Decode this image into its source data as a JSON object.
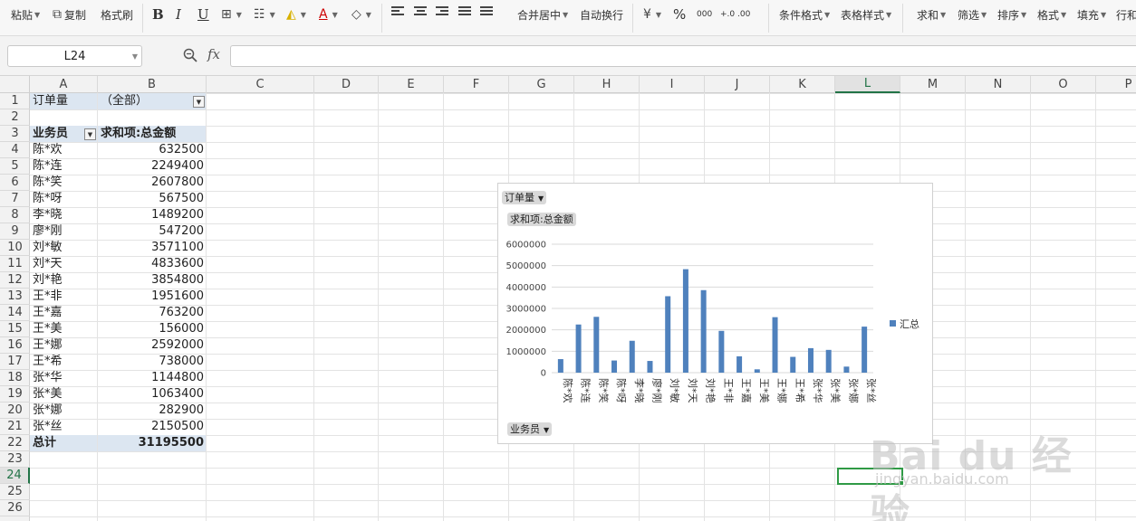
{
  "ribbon": {
    "paste": "粘贴",
    "copy": "复制",
    "format_painter": "格式刷",
    "merge_center": "合并居中",
    "wrap_text": "自动换行",
    "percent": "%",
    "thousands": "000",
    "inc_decimal": "+.0 .00",
    "dec_decimal": ".00 →.0",
    "cond_format": "条件格式",
    "table_style": "表格样式",
    "sum": "求和",
    "filter": "筛选",
    "sort": "排序",
    "format": "格式",
    "fill": "填充",
    "row_col": "行和"
  },
  "formula_bar": {
    "name_box": "L24",
    "fx": "fx",
    "value": ""
  },
  "grid": {
    "columns": [
      "A",
      "B",
      "C",
      "D",
      "E",
      "F",
      "G",
      "H",
      "I",
      "J",
      "K",
      "L",
      "M",
      "N",
      "O",
      "P"
    ],
    "selected_column": "L",
    "rows": [
      "1",
      "2",
      "3",
      "4",
      "5",
      "6",
      "7",
      "8",
      "9",
      "10",
      "11",
      "12",
      "13",
      "14",
      "15",
      "16",
      "17",
      "18",
      "19",
      "20",
      "21",
      "22",
      "23",
      "24",
      "25",
      "26"
    ],
    "selected_row": "24"
  },
  "pivot": {
    "filter_label": "订单量",
    "filter_value": "（全部）",
    "row_header": "业务员",
    "value_header": "求和项:总金额",
    "rows": [
      {
        "name": "陈*欢",
        "value": "632500"
      },
      {
        "name": "陈*连",
        "value": "2249400"
      },
      {
        "name": "陈*笑",
        "value": "2607800"
      },
      {
        "name": "陈*呀",
        "value": "567500"
      },
      {
        "name": "李*晓",
        "value": "1489200"
      },
      {
        "name": "廖*刚",
        "value": "547200"
      },
      {
        "name": "刘*敏",
        "value": "3571100"
      },
      {
        "name": "刘*天",
        "value": "4833600"
      },
      {
        "name": "刘*艳",
        "value": "3854800"
      },
      {
        "name": "王*非",
        "value": "1951600"
      },
      {
        "name": "王*嘉",
        "value": "763200"
      },
      {
        "name": "王*美",
        "value": "156000"
      },
      {
        "name": "王*娜",
        "value": "2592000"
      },
      {
        "name": "王*希",
        "value": "738000"
      },
      {
        "name": "张*华",
        "value": "1144800"
      },
      {
        "name": "张*美",
        "value": "1063400"
      },
      {
        "name": "张*娜",
        "value": "282900"
      },
      {
        "name": "张*丝",
        "value": "2150500"
      }
    ],
    "total_label": "总计",
    "total_value": "31195500"
  },
  "chart_buttons": {
    "filter": "订单量",
    "value_field": "求和项:总金额",
    "axis_field": "业务员"
  },
  "chart_data": {
    "type": "bar",
    "categories": [
      "陈*欢",
      "陈*连",
      "陈*笑",
      "陈*呀",
      "李*晓",
      "廖*刚",
      "刘*敏",
      "刘*天",
      "刘*艳",
      "王*非",
      "王*嘉",
      "王*美",
      "王*娜",
      "王*希",
      "张*华",
      "张*美",
      "张*娜",
      "张*丝"
    ],
    "series": [
      {
        "name": "汇总",
        "values": [
          632500,
          2249400,
          2607800,
          567500,
          1489200,
          547200,
          3571100,
          4833600,
          3854800,
          1951600,
          763200,
          156000,
          2592000,
          738000,
          1144800,
          1063400,
          282900,
          2150500
        ],
        "color": "#4f81bd"
      }
    ],
    "yticks": [
      "0",
      "1000000",
      "2000000",
      "3000000",
      "4000000",
      "5000000",
      "6000000"
    ],
    "ylim": [
      0,
      6000000
    ],
    "grid": true,
    "legend": "right"
  },
  "watermark": {
    "text": "Bai du 经验",
    "sub": "jingyan.baidu.com"
  }
}
